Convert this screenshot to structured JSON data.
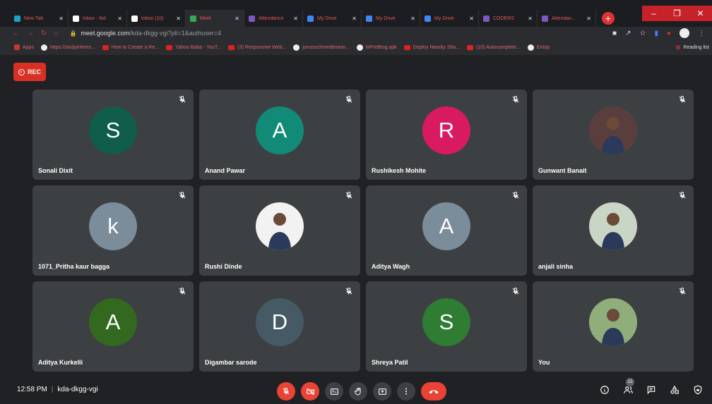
{
  "browser": {
    "tabs": [
      {
        "label": "New Tab",
        "color": "#1aa5c7",
        "active": false
      },
      {
        "label": "Inbox - Ikd",
        "color": "#ffffff",
        "active": false
      },
      {
        "label": "Inbox (10)",
        "color": "#ffffff",
        "active": false
      },
      {
        "label": "Meet",
        "color": "#34a853",
        "active": true
      },
      {
        "label": "Attendance",
        "color": "#7e57c2",
        "active": false
      },
      {
        "label": "My Drive",
        "color": "#4285f4",
        "active": false
      },
      {
        "label": "My Drive",
        "color": "#4285f4",
        "active": false
      },
      {
        "label": "My Drive",
        "color": "#4285f4",
        "active": false
      },
      {
        "label": "CODERS",
        "color": "#7e57c2",
        "active": false
      },
      {
        "label": "Attendan...",
        "color": "#7e57c2",
        "active": false
      }
    ],
    "url_host": "meet.google.com",
    "url_path": "/kda-dkgg-vgi?pli=1&authuser=4",
    "bookmarks": [
      {
        "label": "Apps",
        "icon": "apps-icon"
      },
      {
        "label": "https://studyinhims...",
        "icon": "page-icon"
      },
      {
        "label": "How to Create a Re...",
        "icon": "youtube-icon"
      },
      {
        "label": "Yahoo Baba - YouT...",
        "icon": "youtube-icon"
      },
      {
        "label": "(3) Responsive Web...",
        "icon": "youtube-icon"
      },
      {
        "label": "jonasschmedtmann...",
        "icon": "github-icon"
      },
      {
        "label": "MPIeBlog.apk",
        "icon": "page-icon"
      },
      {
        "label": "Deploy Nearby Sho...",
        "icon": "youtube-icon"
      },
      {
        "label": "(10) Autocomplete...",
        "icon": "youtube-icon"
      },
      {
        "label": "Entop",
        "icon": "page-icon"
      }
    ],
    "reading_list": "Reading list"
  },
  "rec_label": "REC",
  "participants": [
    {
      "name": "Sonali Dixit",
      "initial": "S",
      "color": "#0f5d4a",
      "photo": false
    },
    {
      "name": "Anand Pawar",
      "initial": "A",
      "color": "#128a78",
      "photo": false
    },
    {
      "name": "Rushikesh Mohite",
      "initial": "R",
      "color": "#d81b60",
      "photo": false
    },
    {
      "name": "Gunwant Banait",
      "initial": "",
      "color": "#5a3e3e",
      "photo": true
    },
    {
      "name": "1071_Pritha kaur bagga",
      "initial": "k",
      "color": "#7b8c9a",
      "photo": false
    },
    {
      "name": "Rushi Dinde",
      "initial": "",
      "color": "#f2f2f2",
      "photo": true
    },
    {
      "name": "Aditya Wagh",
      "initial": "A",
      "color": "#7b8c9a",
      "photo": false
    },
    {
      "name": "anjali sinha",
      "initial": "",
      "color": "#c9d6c5",
      "photo": true
    },
    {
      "name": "Aditya Kurkelli",
      "initial": "A",
      "color": "#33691e",
      "photo": false
    },
    {
      "name": "Digambar sarode",
      "initial": "D",
      "color": "#455a64",
      "photo": false
    },
    {
      "name": "Shreya Patil",
      "initial": "S",
      "color": "#2e7d32",
      "photo": false
    },
    {
      "name": "You",
      "initial": "",
      "color": "#8fae7a",
      "photo": true
    }
  ],
  "footer": {
    "time": "12:58 PM",
    "meeting_code": "kda-dkgg-vgi",
    "people_count": "12"
  }
}
